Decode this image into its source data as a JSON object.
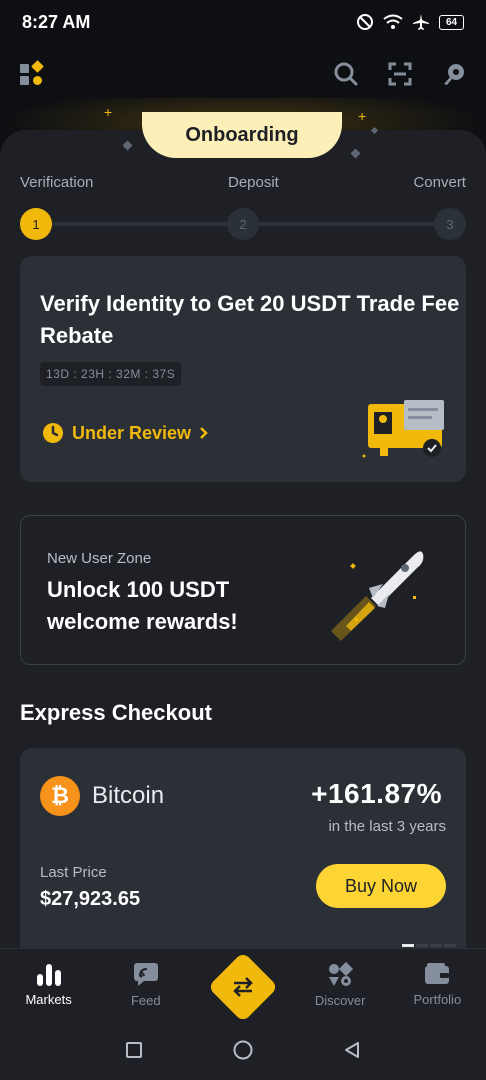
{
  "status_bar": {
    "time": "8:27 AM",
    "battery": "64"
  },
  "onboarding": {
    "tab_label": "Onboarding",
    "steps": [
      {
        "label": "Verification",
        "number": "1"
      },
      {
        "label": "Deposit",
        "number": "2"
      },
      {
        "label": "Convert",
        "number": "3"
      }
    ]
  },
  "verify_card": {
    "title": "Verify Identity to Get 20 USDT Trade Fee Rebate",
    "countdown": "13D : 23H : 32M : 37S",
    "status": "Under Review"
  },
  "user_zone": {
    "caption": "New User Zone",
    "title": "Unlock 100 USDT welcome rewards!"
  },
  "express_checkout": {
    "section_title": "Express Checkout",
    "coin_name": "Bitcoin",
    "change": "+161.87%",
    "change_period": "in the last 3 years",
    "last_price_label": "Last Price",
    "last_price": "$27,923.65",
    "buy_label": "Buy Now"
  },
  "bottom_nav": {
    "items": [
      {
        "label": "Markets",
        "icon": "bar-chart-icon"
      },
      {
        "label": "Feed",
        "icon": "feed-icon"
      },
      {
        "label": "",
        "icon": "trade-swap-icon"
      },
      {
        "label": "Discover",
        "icon": "discover-icon"
      },
      {
        "label": "Portfolio",
        "icon": "wallet-icon"
      }
    ]
  },
  "colors": {
    "accent": "#f0b90b",
    "background": "#1e2026",
    "card": "#2b2f36"
  }
}
